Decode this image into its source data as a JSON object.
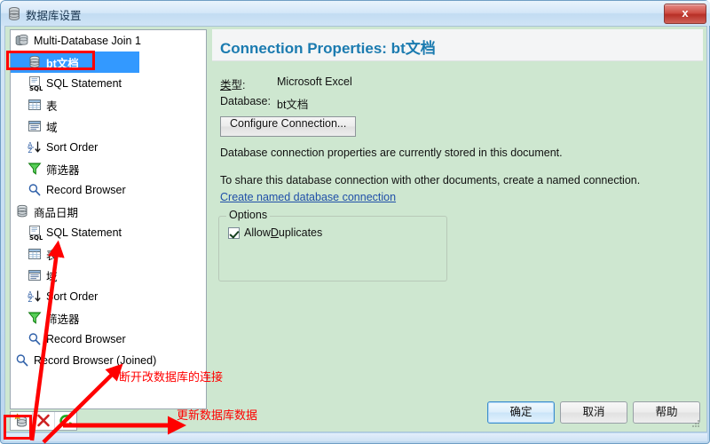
{
  "window": {
    "title": "数据库设置",
    "title_icon": "database-icon",
    "close_label": "x"
  },
  "tree": {
    "items": [
      {
        "label": "Multi-Database Join 1",
        "icon": "multi-database-icon",
        "level": 0,
        "selected": false
      },
      {
        "label": "bt文档",
        "icon": "database-icon",
        "level": 1,
        "selected": true
      },
      {
        "label": "SQL Statement",
        "icon": "sql-statement-icon",
        "level": 1,
        "selected": false
      },
      {
        "label": "表",
        "icon": "table-icon",
        "level": 1,
        "selected": false
      },
      {
        "label": "域",
        "icon": "fields-icon",
        "level": 1,
        "selected": false
      },
      {
        "label": "Sort Order",
        "icon": "sort-order-icon",
        "level": 1,
        "selected": false
      },
      {
        "label": "筛选器",
        "icon": "filter-icon",
        "level": 1,
        "selected": false
      },
      {
        "label": "Record Browser",
        "icon": "record-browser-icon",
        "level": 1,
        "selected": false
      },
      {
        "label": "商品日期",
        "icon": "database-icon",
        "level": 0,
        "selected": false
      },
      {
        "label": "SQL Statement",
        "icon": "sql-statement-icon",
        "level": 1,
        "selected": false
      },
      {
        "label": "表",
        "icon": "table-icon",
        "level": 1,
        "selected": false
      },
      {
        "label": "域",
        "icon": "fields-icon",
        "level": 1,
        "selected": false
      },
      {
        "label": "Sort Order",
        "icon": "sort-order-icon",
        "level": 1,
        "selected": false
      },
      {
        "label": "筛选器",
        "icon": "filter-icon",
        "level": 1,
        "selected": false
      },
      {
        "label": "Record Browser",
        "icon": "record-browser-icon",
        "level": 1,
        "selected": false
      },
      {
        "label": "Record Browser (Joined)",
        "icon": "record-browser-icon",
        "level": 0,
        "selected": false
      }
    ],
    "toolbar": [
      {
        "icon": "add-database-icon",
        "name": "add-database-button"
      },
      {
        "icon": "disconnect-database-icon",
        "name": "disconnect-database-button"
      },
      {
        "icon": "refresh-database-icon",
        "name": "refresh-database-button"
      }
    ]
  },
  "panel": {
    "title": "Connection Properties: bt文档",
    "type_label": "类型:",
    "type_value": "Microsoft Excel",
    "database_label": "Database:",
    "database_value": "bt文档",
    "configure_button": "Configure Connection...",
    "description_1": "Database connection properties are currently stored in this document.",
    "description_2": "To share this database connection with other documents, create a named connection.",
    "named_connection_link": "Create named database connection",
    "options": {
      "legend": "Options",
      "allow_duplicates_label": "Allow ",
      "allow_duplicates_accel": "D",
      "allow_duplicates_rest": "uplicates",
      "allow_duplicates_checked": true
    }
  },
  "buttons": {
    "ok": "确定",
    "cancel": "取消",
    "help": "帮助"
  },
  "annotations": {
    "disconnect_note": "断开改数据库的连接",
    "refresh_note": "更新数据库数据",
    "color": "#ff0000"
  }
}
